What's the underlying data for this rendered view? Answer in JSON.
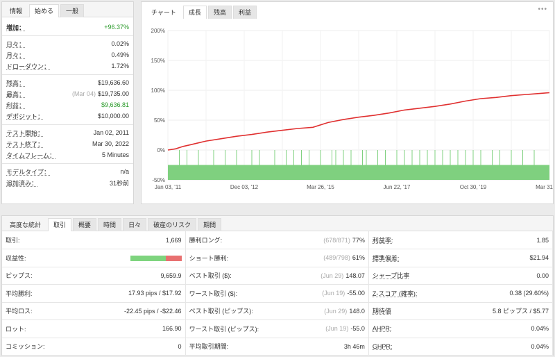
{
  "left": {
    "tabs": [
      "情報",
      "始める",
      "一般"
    ],
    "active_tab": 1,
    "gain": {
      "label": "増加：",
      "value": "+96.37%"
    },
    "group1": [
      {
        "label": "日々：",
        "value": "0.02%"
      },
      {
        "label": "月々：",
        "value": "0.49%"
      },
      {
        "label": "ドローダウン：",
        "value": "1.72%"
      }
    ],
    "group2": [
      {
        "label": "残高：",
        "sub": "",
        "value": "$19,636.60"
      },
      {
        "label": "最高：",
        "sub": "(Mar 04)",
        "value": "$19,735.00"
      },
      {
        "label": "利益：",
        "sub": "",
        "value": "$9,636.81",
        "green": true
      },
      {
        "label": "デポジット：",
        "sub": "",
        "value": "$10,000.00"
      }
    ],
    "group3": [
      {
        "label": "テスト開始：",
        "value": "Jan 02, 2011"
      },
      {
        "label": "テスト終了：",
        "value": "Mar 30, 2022"
      },
      {
        "label": "タイムフレーム：",
        "value": "5 Minutes"
      }
    ],
    "group4": [
      {
        "label": "モデルタイプ：",
        "value": "n/a"
      },
      {
        "label": "追加済み：",
        "value": "31秒前"
      }
    ]
  },
  "chart_panel": {
    "tabs": [
      "チャート",
      "成長",
      "残高",
      "利益"
    ],
    "active_tab": 1,
    "menu": "•••"
  },
  "chart_data": {
    "type": "line",
    "yticks": [
      "200%",
      "150%",
      "100%",
      "50%",
      "0%",
      "-50%"
    ],
    "ytick_values": [
      200,
      150,
      100,
      50,
      0,
      -50
    ],
    "ylim": [
      -50,
      200
    ],
    "xticks": [
      "Jan 03, '11",
      "Dec 03, '12",
      "Mar 26, '15",
      "Jun 22, '17",
      "Oct 30, '19",
      "Mar 31, '22"
    ],
    "series": [
      {
        "color": "#e03030",
        "x": [
          0,
          2,
          4,
          6,
          8,
          10,
          14,
          18,
          22,
          26,
          30,
          34,
          38,
          42,
          46,
          50,
          54,
          58,
          62,
          66,
          70,
          74,
          78,
          82,
          86,
          90,
          94,
          98,
          100
        ],
        "y": [
          0,
          2,
          6,
          9,
          12,
          15,
          19,
          23,
          26,
          30,
          33,
          36,
          38,
          46,
          51,
          55,
          58,
          62,
          67,
          70,
          73,
          77,
          82,
          86,
          88,
          91,
          93,
          95,
          96
        ]
      }
    ],
    "bar_band": {
      "color": "#7fd07f",
      "range": [
        -50,
        -25
      ]
    },
    "grid": true,
    "bar_color": "#8fd18f"
  },
  "bottom": {
    "tabs": [
      "高度な統計",
      "取引",
      "概要",
      "時間",
      "日々",
      "破産のリスク",
      "期間"
    ],
    "active_tab": 1,
    "rows": [
      [
        {
          "l": "取引:",
          "v": "1,669"
        },
        {
          "l": "勝利ロング:",
          "m": "(678/871)",
          "v": "77%"
        },
        {
          "l": "利益率:",
          "v": "1.85",
          "u": true
        }
      ],
      [
        {
          "l": "収益性:",
          "bar": 0.69
        },
        {
          "l": "ショート勝利:",
          "m": "(489/798)",
          "v": "61%"
        },
        {
          "l": "標準偏差:",
          "v": "$21.94",
          "u": true
        }
      ],
      [
        {
          "l": "ピップス:",
          "v": "9,659.9"
        },
        {
          "l": "ベスト取引 ($):",
          "m": "(Jun 29)",
          "v": "148.07"
        },
        {
          "l": "シャープ比率",
          "v": "0.00",
          "u": true
        }
      ],
      [
        {
          "l": "平均勝利:",
          "v": "17.93 pips / $17.92"
        },
        {
          "l": "ワースト取引 ($):",
          "m": "(Jun 19)",
          "v": "-55.00"
        },
        {
          "l": "Z-スコア (確率):",
          "v": "0.38 (29.60%)",
          "u": true
        }
      ],
      [
        {
          "l": "平均ロス:",
          "v": "-22.45 pips / -$22.46"
        },
        {
          "l": "ベスト取引 (ピップス):",
          "m": "(Jun 29)",
          "v": "148.0"
        },
        {
          "l": "期待値",
          "v": "5.8 ピップス / $5.77",
          "u": true
        }
      ],
      [
        {
          "l": "ロット:",
          "v": "166.90"
        },
        {
          "l": "ワースト取引 (ピップス):",
          "m": "(Jun 19)",
          "v": "-55.0"
        },
        {
          "l": "AHPR:",
          "v": "0.04%",
          "u": true
        }
      ],
      [
        {
          "l": "コミッション:",
          "v": "0"
        },
        {
          "l": "平均取引期間:",
          "m": "",
          "v": "3h 46m"
        },
        {
          "l": "GHPR:",
          "v": "0.04%",
          "u": true
        }
      ]
    ]
  }
}
